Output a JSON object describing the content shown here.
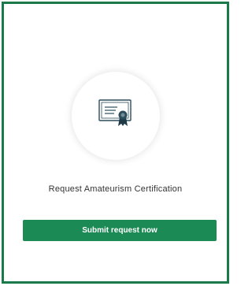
{
  "card": {
    "title": "Request Amateurism Certification",
    "icon": "certificate-icon",
    "submit_label": "Submit request now"
  },
  "colors": {
    "accent": "#1b8a54",
    "border": "#1b7a4a",
    "seal": "#2b4d5c"
  }
}
